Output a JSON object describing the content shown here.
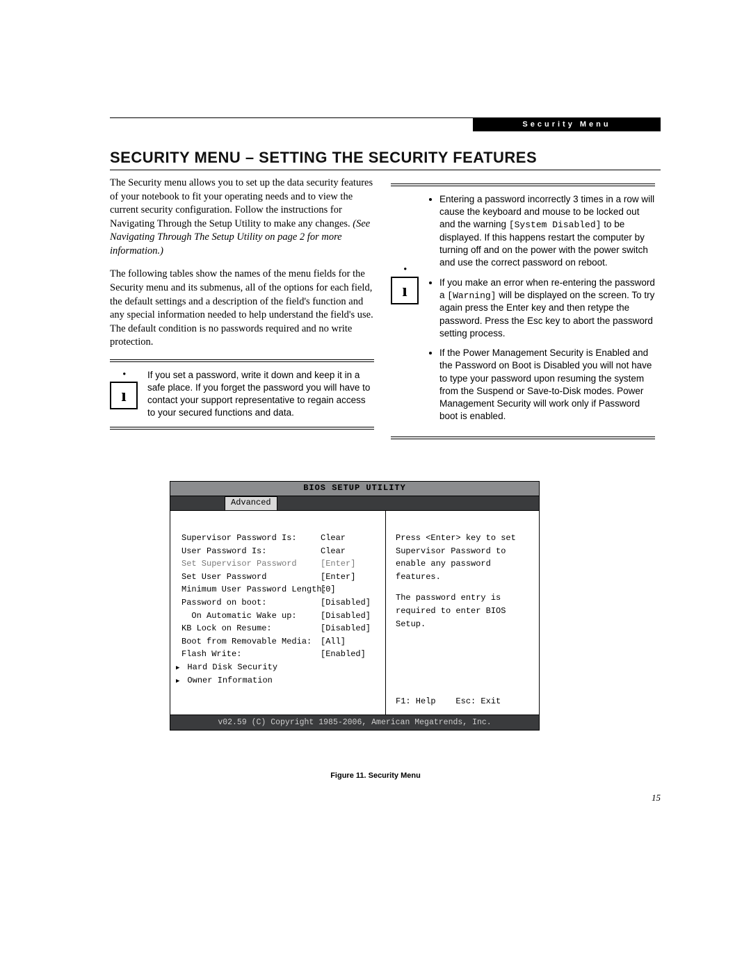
{
  "header_badge": "Security Menu",
  "title": "SECURITY MENU – SETTING THE SECURITY FEATURES",
  "left": {
    "p1a": "The Security menu allows you to set up the data security features of your notebook to fit your operating needs and to view the current security configuration. Follow the instructions for Navigating Through the Setup Utility to make any changes. ",
    "p1b": "(See Navigating Through The Setup Utility on page 2 for more information.)",
    "p2": "The following tables show the names of the menu fields for the Security menu and its submenus, all of the options for each field, the default settings and a description of the field's function and any special information needed to help understand the field's use. The default condition is no passwords required and no write protection.",
    "note": "If you set a password, write it down and keep it in a safe place. If you forget the password you will have to contact your support representative to regain access to your secured functions and data."
  },
  "right": {
    "b1a": "Entering a password incorrectly 3 times in a row will cause the keyboard and mouse to be locked out and the warning ",
    "b1code": "[System Disabled]",
    "b1b": " to be displayed. If this happens restart the computer by turning off and on the power with the power switch and use the correct password on reboot.",
    "b2a": "If you make an error when re-entering the password a ",
    "b2code": "[Warning]",
    "b2b": " will be displayed on the screen. To try again press the Enter key and then retype the password. Press the Esc key to abort the password setting process.",
    "b3": "If the Power Management Security is Enabled and the Password on Boot is Disabled you will not have to type your password upon resuming the system from the Suspend or Save-to-Disk modes. Power Management Security will work only if Password boot is enabled."
  },
  "bios": {
    "title": "BIOS SETUP UTILITY",
    "tab": "Advanced",
    "rows": [
      {
        "label": "Supervisor Password Is:",
        "value": "Clear"
      },
      {
        "label": "User Password Is:",
        "value": "Clear"
      },
      {
        "label": "",
        "value": ""
      },
      {
        "label": "Set Supervisor Password",
        "value": "[Enter]",
        "highlight": true
      },
      {
        "label": "Set User Password",
        "value": "[Enter]"
      },
      {
        "label": "Minimum User Password Length:",
        "value": "[0]"
      },
      {
        "label": "Password on boot:",
        "value": "[Disabled]"
      },
      {
        "label": "  On Automatic Wake up:",
        "value": "[Disabled]"
      },
      {
        "label": "KB Lock on Resume:",
        "value": "[Disabled]"
      },
      {
        "label": "Boot from Removable Media:",
        "value": "[All]"
      },
      {
        "label": "Flash Write:",
        "value": "[Enabled]"
      },
      {
        "label": "Hard Disk Security",
        "value": "",
        "arrow": true
      },
      {
        "label": "Owner Information",
        "value": "",
        "arrow": true
      }
    ],
    "help1": "Press <Enter> key to set Supervisor Password to enable any password features.",
    "help2": "The password entry is required to enter BIOS Setup.",
    "help_footer_left": "F1: Help",
    "help_footer_right": "Esc: Exit",
    "footer": "v02.59 (C) Copyright 1985-2006, American Megatrends, Inc."
  },
  "figure_caption": "Figure 11.  Security Menu",
  "page_number": "15"
}
